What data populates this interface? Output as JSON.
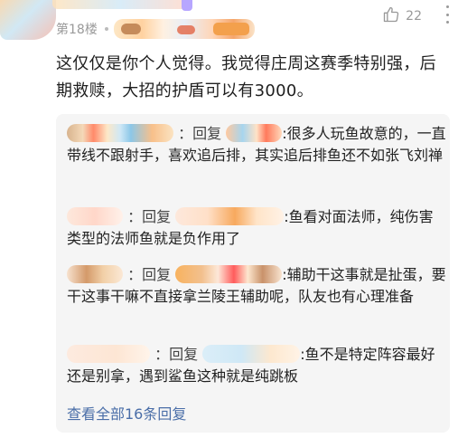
{
  "header": {
    "floor_label": "第18楼",
    "likes": "22"
  },
  "post": {
    "text": "这仅仅是你个人觉得。我觉得庄周这赛季特别强，后期救赎，大招的护盾可以有3000。"
  },
  "replies": [
    {
      "reply_word": "回复",
      "text": ":很多人玩鱼故意的，一直带线不跟射手，喜欢追后排，其实追后排鱼还不如张飞刘禅"
    },
    {
      "reply_word": "回复",
      "text": ":鱼看对面法师，纯伤害类型的法师鱼就是负作用了"
    },
    {
      "reply_word": "回复",
      "text": ":辅助干这事就是扯蛋，要干这事干嘛不直接拿兰陵王辅助呢，队友也有心理准备"
    },
    {
      "reply_word": "回复",
      "text": ":鱼不是特定阵容最好还是别拿，遇到鲨鱼这种就是纯跳板"
    }
  ],
  "view_all": "查看全部16条回复",
  "colors": {
    "link": "#4a6ea8",
    "reply_bg": "#f5f5f5",
    "meta_gray": "#9a9a9a"
  },
  "icons": [
    "thumbs-up-icon",
    "more-vertical-icon"
  ]
}
